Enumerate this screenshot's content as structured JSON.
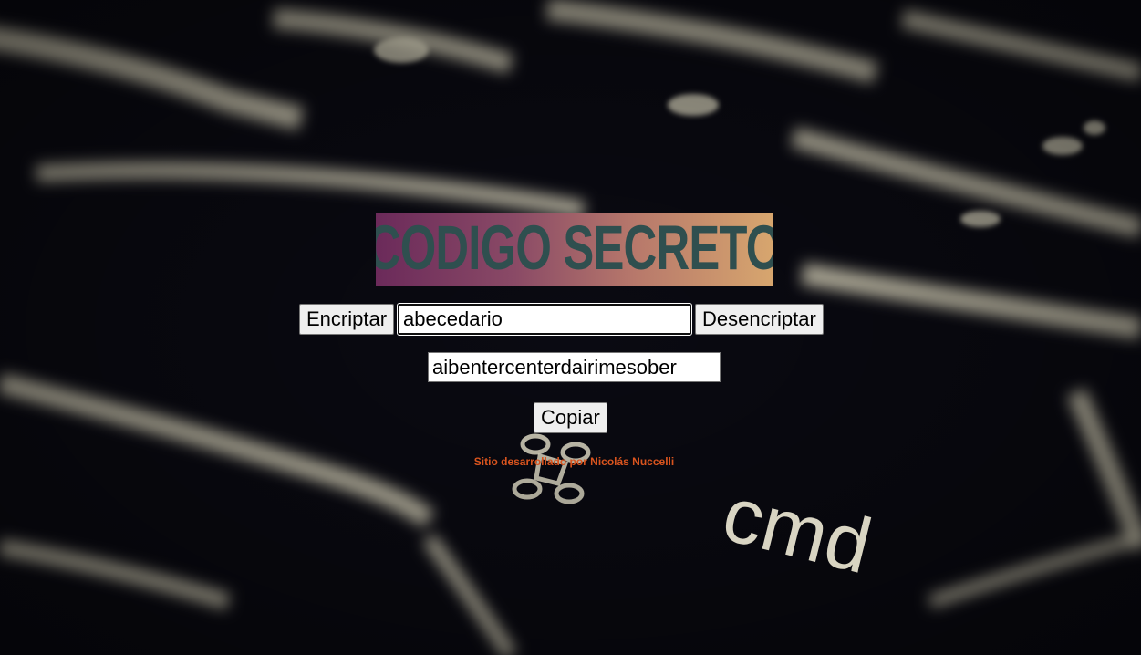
{
  "title": "CODIGO SECRETO",
  "buttons": {
    "encrypt": "Encriptar",
    "decrypt": "Desencriptar",
    "copy": "Copiar"
  },
  "input": {
    "value": "abecedario"
  },
  "result": {
    "value": "aibentercenterdairimesober"
  },
  "footer": {
    "credit": "Sitio desarrollado por Nicolás Nuccelli"
  },
  "background": {
    "key_label": "cmd"
  },
  "colors": {
    "title_text": "#2f4f4f",
    "title_gradient_start": "#6b2a5a",
    "title_gradient_end": "#d7a66e",
    "credit_text": "#d9541e"
  }
}
